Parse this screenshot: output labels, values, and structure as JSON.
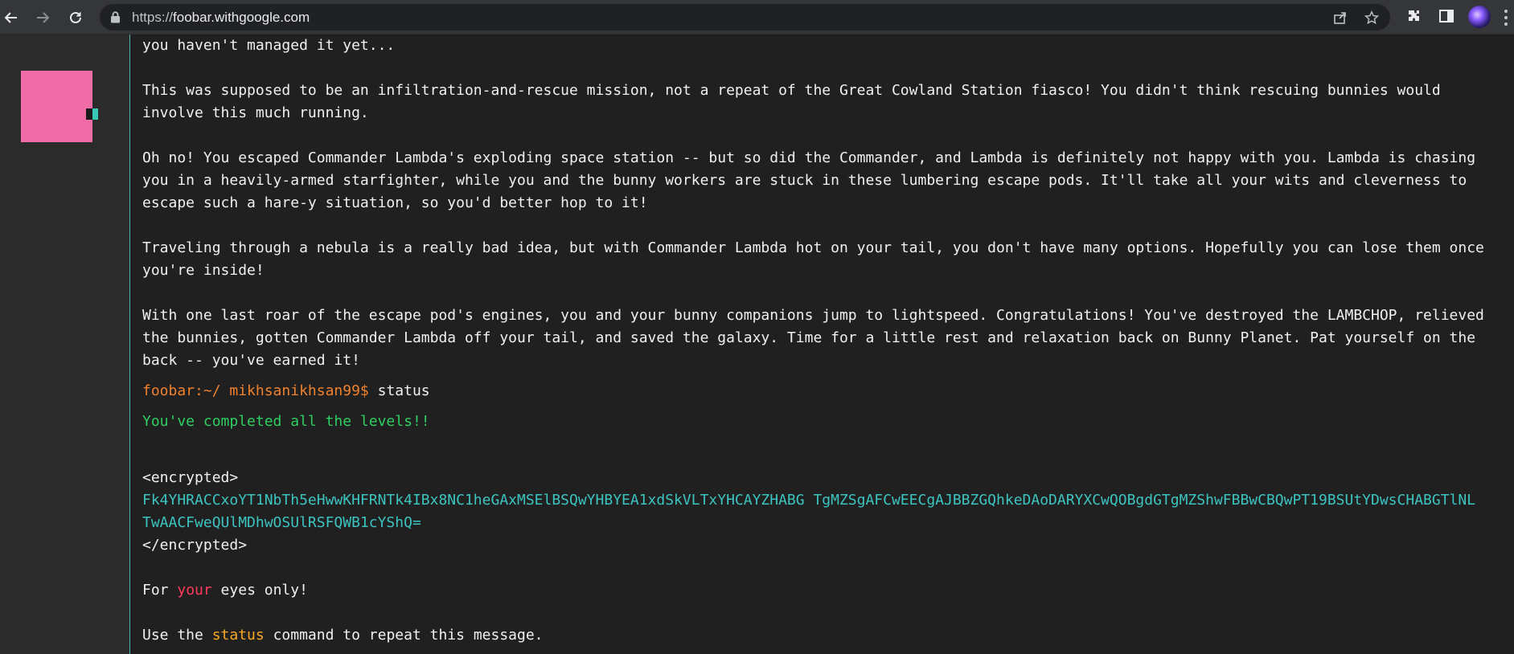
{
  "browser": {
    "url_scheme": "https://",
    "url_host": "foobar.withgoogle.com",
    "icons": {
      "back": "arrow-left-icon",
      "forward": "arrow-right-icon",
      "reload": "reload-icon",
      "lock": "lock-icon",
      "share": "share-icon",
      "bookmark": "star-icon",
      "extensions": "puzzle-icon",
      "side_panel": "side-panel-icon",
      "profile": "avatar",
      "menu": "more-vertical-icon"
    }
  },
  "colors": {
    "background": "#202020",
    "sidebar": "#2b2b2b",
    "logo": "#f06ca6",
    "prompt": "#f0812d",
    "success": "#2fce62",
    "encrypted": "#3cc4c0",
    "emphasis": "#ff3b5c",
    "command": "#f7a823"
  },
  "terminal": {
    "intro_tail": "you haven't managed it yet...",
    "para1": [
      "This was supposed to be an infiltration-and-rescue mission, not a repeat of the Great Cowland Station fiasco! You didn't think rescuing bunnies would",
      "involve this much running."
    ],
    "para2": [
      "Oh no! You escaped Commander Lambda's exploding space station -- but so did the Commander, and Lambda is definitely not happy with you. Lambda is chasing",
      "you in a heavily-armed starfighter, while you and the bunny workers are stuck in these lumbering escape pods. It'll take all your wits and cleverness to",
      "escape such a hare-y situation, so you'd better hop to it!"
    ],
    "para3": [
      "Traveling through a nebula is a really bad idea, but with Commander Lambda hot on your tail, you don't have many options. Hopefully you can lose them once",
      "you're inside!"
    ],
    "para4": [
      "With one last roar of the escape pod's engines, you and your bunny companions jump to lightspeed. Congratulations! You've destroyed the LAMBCHOP, relieved",
      "the bunnies, gotten Commander Lambda off your tail, and saved the galaxy. Time for a little rest and relaxation back on Bunny Planet. Pat yourself on the",
      "back -- you've earned it!"
    ],
    "prompt": "foobar:~/ mikhsanikhsan99$",
    "command": " status",
    "completed": "You've completed all the levels!!",
    "encrypted_open": "<encrypted>",
    "encrypted_lines": [
      "Fk4YHRACCxoYT1NbTh5eHwwKHFRNTk4IBx8NC1heGAxMSElBSQwYHBYEA1xdSkVLTxYHCAYZHABG TgMZSgAFCwEECgAJBBZGQhkeDAoDARYXCwQOBgdGTgMZShwFBBwCBQwPT19BSUtYDwsCHABGTlNL",
      "TwAACFweQUlMDhwOSUlRSFQWB1cYShQ="
    ],
    "encrypted_close": "</encrypted>",
    "eyes_pre": "For ",
    "eyes_word": "your",
    "eyes_post": " eyes only!",
    "use_pre": "Use the ",
    "use_cmd": "status",
    "use_post": " command to repeat this message."
  }
}
